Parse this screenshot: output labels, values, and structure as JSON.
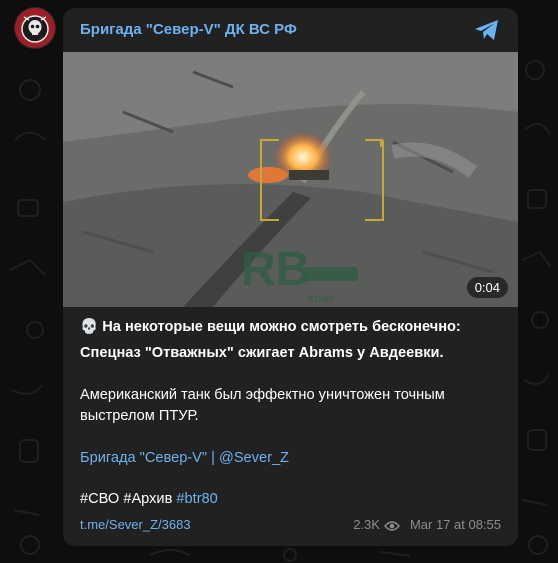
{
  "channel": {
    "name": "Бригада \"Север-V\" ДК ВС РФ",
    "avatar_color": "#9b1f25",
    "link_color": "#6cb2f0"
  },
  "video": {
    "duration": "0:04",
    "watermark_main": "RB",
    "watermark_sub": "BTR80"
  },
  "post": {
    "emoji": "💀",
    "headline_line1": "На некоторые вещи можно смотреть бесконечно:",
    "headline_line2": "Спецназ \"Отважных\" сжигает Abrams у Авдеевки.",
    "body_line1": "Американский танк был эффектно уничтожен точным",
    "body_line2": "выстрелом ПТУР.",
    "signature_name": "Бригада \"Север-V\"",
    "signature_separator": " | ",
    "signature_handle": "@Sever_Z",
    "hashtag_1": "#СВО",
    "hashtag_2": "#Архив",
    "hashtag_3": "#btr80"
  },
  "footer": {
    "link": "t.me/Sever_Z/3683",
    "views": "2.3K",
    "date": "Mar 17 at 08:55"
  },
  "icons": {
    "telegram": "telegram-icon",
    "eye": "eye-icon",
    "avatar": "skull-emblem"
  }
}
